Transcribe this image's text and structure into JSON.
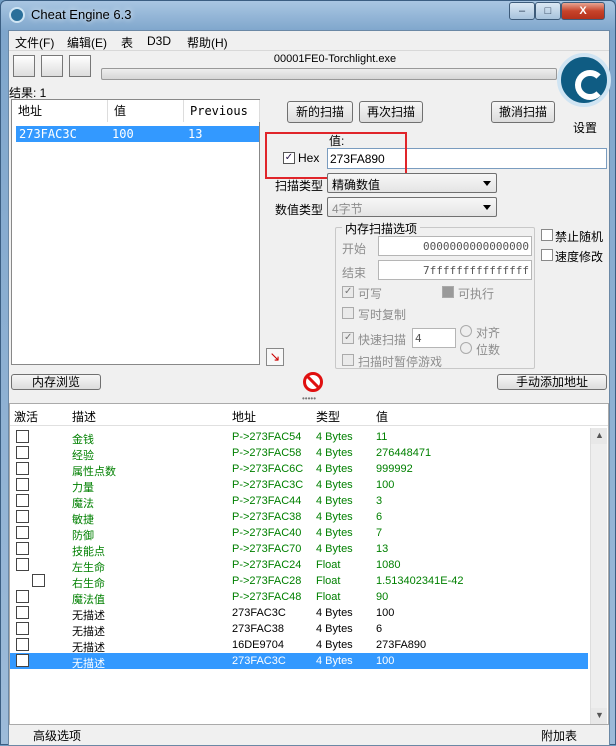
{
  "window": {
    "title": "Cheat Engine 6.3",
    "minimize": "–",
    "maximize": "□",
    "close": "X"
  },
  "menu": [
    "文件(F)",
    "编辑(E)",
    "表",
    "D3D",
    "帮助(H)"
  ],
  "process_name": "00001FE0-Torchlight.exe",
  "result_label": "结果: 1",
  "settings_label": "设置",
  "found_list": {
    "headers": [
      "地址",
      "值",
      "Previous"
    ],
    "rows": [
      {
        "address": "273FAC3C",
        "value": "100",
        "previous": "13"
      }
    ]
  },
  "buttons": {
    "first_scan": "新的扫描",
    "next_scan": "再次扫描",
    "undo_scan": "撤消扫描",
    "memory_view": "内存浏览",
    "add_address": "手动添加地址"
  },
  "value_label": "值:",
  "hex_label": "Hex",
  "hex_check": "✓",
  "value_input": "273FA890",
  "scan_type_label": "扫描类型",
  "scan_type_value": "精确数值",
  "value_type_label": "数值类型",
  "value_type_value": "4字节",
  "mem_options": {
    "title": "内存扫描选项",
    "start_label": "开始",
    "start_value": "0000000000000000",
    "stop_label": "结束",
    "stop_value": "7fffffffffffffff",
    "writable": "可写",
    "executable": "可执行",
    "copy_on_write": "写时复制",
    "fast_scan": "快速扫描",
    "fast_scan_value": "4",
    "alignment": "对齐",
    "last_digits": "位数",
    "pause_game": "扫描时暂停游戏"
  },
  "unrandomizer": "禁止随机",
  "speedhack": "速度修改",
  "check_mark": "✓",
  "pointer_icon": "↘",
  "splitter": "•••••",
  "cheat_table": {
    "headers": [
      "激活",
      "描述",
      "地址",
      "类型",
      "值"
    ],
    "rows": [
      {
        "desc": "金钱",
        "address": "P->273FAC54",
        "type": "4 Bytes",
        "value": "11",
        "color": "#008000"
      },
      {
        "desc": "经验",
        "address": "P->273FAC58",
        "type": "4 Bytes",
        "value": "276448471",
        "color": "#008000"
      },
      {
        "desc": "属性点数",
        "address": "P->273FAC6C",
        "type": "4 Bytes",
        "value": "999992",
        "color": "#008000"
      },
      {
        "desc": "力量",
        "address": "P->273FAC3C",
        "type": "4 Bytes",
        "value": "100",
        "color": "#008000"
      },
      {
        "desc": "魔法",
        "address": "P->273FAC44",
        "type": "4 Bytes",
        "value": "3",
        "color": "#008000"
      },
      {
        "desc": "敏捷",
        "address": "P->273FAC38",
        "type": "4 Bytes",
        "value": "6",
        "color": "#008000"
      },
      {
        "desc": "防御",
        "address": "P->273FAC40",
        "type": "4 Bytes",
        "value": "7",
        "color": "#008000"
      },
      {
        "desc": "技能点",
        "address": "P->273FAC70",
        "type": "4 Bytes",
        "value": "13",
        "color": "#008000"
      },
      {
        "desc": "左生命",
        "address": "P->273FAC24",
        "type": "Float",
        "value": "1080",
        "color": "#008000"
      },
      {
        "desc": "右生命",
        "address": "P->273FAC28",
        "type": "Float",
        "value": "1.513402341E-42",
        "color": "#008000",
        "indent": true
      },
      {
        "desc": "魔法值",
        "address": "P->273FAC48",
        "type": "Float",
        "value": "90",
        "color": "#008000"
      },
      {
        "desc": "无描述",
        "address": "273FAC3C",
        "type": "4 Bytes",
        "value": "100",
        "color": "#000000"
      },
      {
        "desc": "无描述",
        "address": "273FAC38",
        "type": "4 Bytes",
        "value": "6",
        "color": "#000000"
      },
      {
        "desc": "无描述",
        "address": "16DE9704",
        "type": "4 Bytes",
        "value": "273FA890",
        "color": "#000000"
      },
      {
        "desc": "无描述",
        "address": "273FAC3C",
        "type": "4 Bytes",
        "value": "100",
        "color": "#ffffff",
        "selected": true
      }
    ]
  },
  "scroll": {
    "up": "▲",
    "down": "▼"
  },
  "status": {
    "advanced": "高级选项",
    "extras": "附加表"
  }
}
